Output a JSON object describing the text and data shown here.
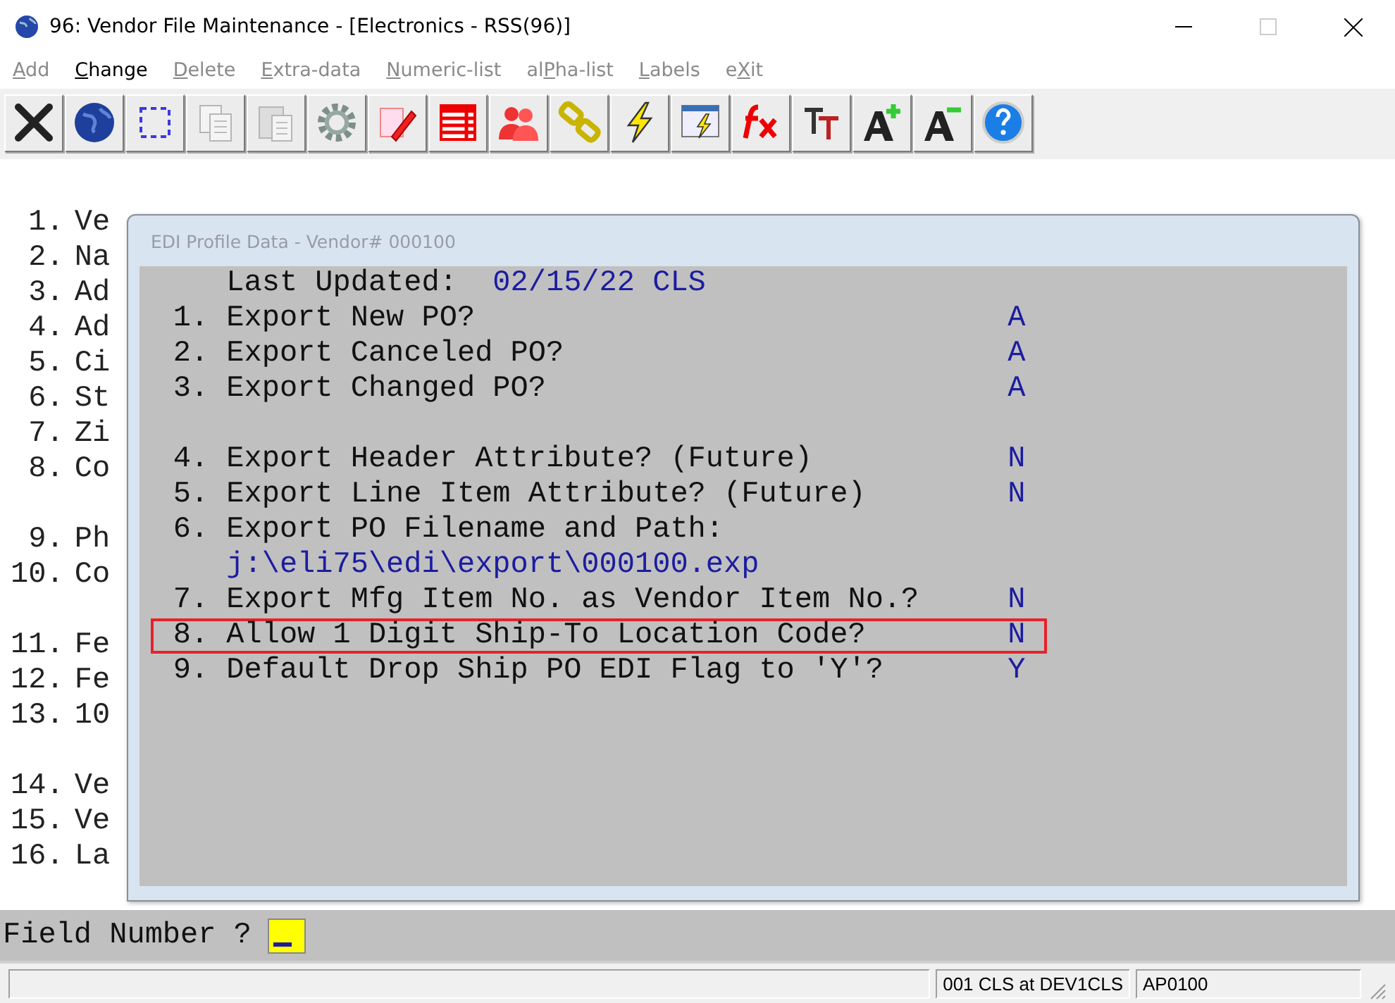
{
  "window": {
    "title": "96: Vendor File Maintenance - [Electronics - RSS(96)]"
  },
  "menu": [
    {
      "key": "A",
      "post": "dd",
      "disabled": true
    },
    {
      "key": "C",
      "post": "hange",
      "disabled": false
    },
    {
      "key": "D",
      "post": "elete",
      "disabled": true
    },
    {
      "key": "E",
      "post": "xtra-data",
      "disabled": true
    },
    {
      "key": "N",
      "post": "umeric-list",
      "disabled": true
    },
    {
      "pre": "al",
      "key": "P",
      "post": "ha-list",
      "disabled": true
    },
    {
      "key": "L",
      "post": "abels",
      "disabled": true
    },
    {
      "pre": "e",
      "key": "X",
      "post": "it",
      "disabled": true
    }
  ],
  "toolbar": [
    {
      "kind": "exit",
      "disabled": false
    },
    {
      "kind": "globe",
      "disabled": false
    },
    {
      "kind": "select",
      "disabled": false
    },
    {
      "kind": "copy",
      "disabled": true
    },
    {
      "kind": "paste",
      "disabled": true
    },
    {
      "kind": "gear",
      "disabled": false
    },
    {
      "kind": "edit",
      "disabled": false
    },
    {
      "kind": "table",
      "disabled": false
    },
    {
      "kind": "people",
      "disabled": false
    },
    {
      "kind": "chain",
      "disabled": false
    },
    {
      "kind": "bolt",
      "disabled": false
    },
    {
      "kind": "panel",
      "disabled": false
    },
    {
      "kind": "fx",
      "disabled": false
    },
    {
      "kind": "font",
      "disabled": false
    },
    {
      "kind": "grow",
      "disabled": false
    },
    {
      "kind": "shrink",
      "disabled": false
    },
    {
      "kind": "help",
      "disabled": false
    }
  ],
  "fields": [
    {
      "group": [
        {
          "number": "1.",
          "text": "Ve"
        },
        {
          "number": "2.",
          "text": "Na"
        },
        {
          "number": "3.",
          "text": "Ad"
        },
        {
          "number": "4.",
          "text": "Ad"
        },
        {
          "number": "5.",
          "text": "Ci"
        },
        {
          "number": "6.",
          "text": "St"
        },
        {
          "number": "7.",
          "text": "Zi"
        },
        {
          "number": "8.",
          "text": "Co"
        }
      ]
    },
    {
      "group": [
        {
          "number": "9.",
          "text": "Ph"
        },
        {
          "number": "10.",
          "text": "Co"
        }
      ]
    },
    {
      "group": [
        {
          "number": "11.",
          "text": "Fe"
        },
        {
          "number": "12.",
          "text": "Fe"
        },
        {
          "number": "13.",
          "text": "10"
        }
      ]
    },
    {
      "group": [
        {
          "number": "14.",
          "text": "Ve"
        },
        {
          "number": "15.",
          "text": "Ve"
        },
        {
          "number": "16.",
          "text": "La"
        }
      ]
    }
  ],
  "dialog": {
    "title": "EDI Profile Data - Vendor#  000100",
    "last_updated": {
      "label": "Last Updated:",
      "value": "02/15/22 CLS"
    },
    "groups": [
      {
        "items": [
          {
            "number": "1.",
            "label": "Export New PO?",
            "value": "A",
            "highlighted": false
          },
          {
            "number": "2.",
            "label": "Export Canceled PO?",
            "value": "A",
            "highlighted": false
          },
          {
            "number": "3.",
            "label": "Export Changed PO?",
            "value": "A",
            "highlighted": false
          }
        ]
      },
      {
        "items": [
          {
            "number": "4.",
            "label": "Export Header Attribute? (Future)",
            "value": "N",
            "highlighted": false
          },
          {
            "number": "5.",
            "label": "Export Line Item Attribute? (Future)",
            "value": "N",
            "highlighted": false
          },
          {
            "number": "6.",
            "label": "Export PO Filename and Path:",
            "path": "j:\\eli75\\edi\\export\\000100.exp",
            "highlighted": false
          },
          {
            "number": "7.",
            "label": "Export Mfg Item No. as Vendor Item No.?",
            "value": "N",
            "highlighted": false
          },
          {
            "number": "8.",
            "label": "Allow 1 Digit Ship-To Location Code?",
            "value": "N",
            "highlighted": true
          },
          {
            "number": "9.",
            "label": "Default Drop Ship PO EDI Flag to 'Y'?",
            "value": "Y",
            "highlighted": false
          }
        ]
      }
    ]
  },
  "prompt": {
    "label": "Field Number ?"
  },
  "status_bar": [
    {
      "text": "001 CLS at DEV1CLS"
    },
    {
      "text": "AP0100"
    }
  ]
}
